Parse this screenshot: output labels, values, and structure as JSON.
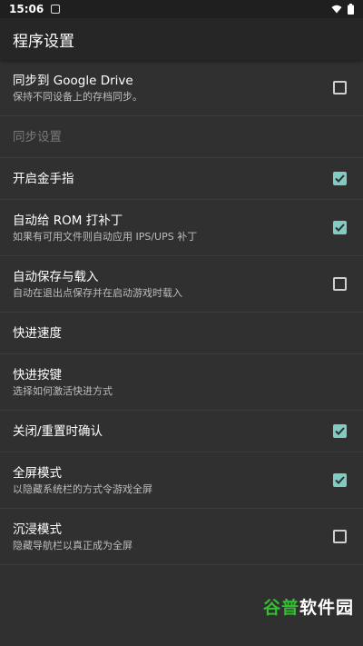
{
  "status": {
    "time": "15:06"
  },
  "app_bar": {
    "title": "程序设置"
  },
  "settings": [
    {
      "title": "同步到 Google Drive",
      "summary": "保持不同设备上的存档同步。",
      "checkbox": "unchecked",
      "disabled": false
    },
    {
      "title": "同步设置",
      "summary": "",
      "checkbox": "none",
      "disabled": true
    },
    {
      "title": "开启金手指",
      "summary": "",
      "checkbox": "checked",
      "disabled": false
    },
    {
      "title": "自动给 ROM 打补丁",
      "summary": "如果有可用文件则自动应用 IPS/UPS 补丁",
      "checkbox": "checked",
      "disabled": false
    },
    {
      "title": "自动保存与载入",
      "summary": "自动在退出点保存并在启动游戏时载入",
      "checkbox": "unchecked",
      "disabled": false
    },
    {
      "title": "快进速度",
      "summary": "",
      "checkbox": "none",
      "disabled": false
    },
    {
      "title": "快进按键",
      "summary": "选择如何激活快进方式",
      "checkbox": "none",
      "disabled": false
    },
    {
      "title": "关闭/重置时确认",
      "summary": "",
      "checkbox": "checked",
      "disabled": false
    },
    {
      "title": "全屏模式",
      "summary": "以隐藏系统栏的方式令游戏全屏",
      "checkbox": "checked",
      "disabled": false
    },
    {
      "title": "沉浸模式",
      "summary": "隐藏导航栏以真正成为全屏",
      "checkbox": "unchecked",
      "disabled": false
    }
  ],
  "watermark": {
    "part1": "谷普",
    "part2": "软件园"
  },
  "colors": {
    "accent": "#80cbc4",
    "background": "#303030",
    "app_bar": "#262626"
  }
}
